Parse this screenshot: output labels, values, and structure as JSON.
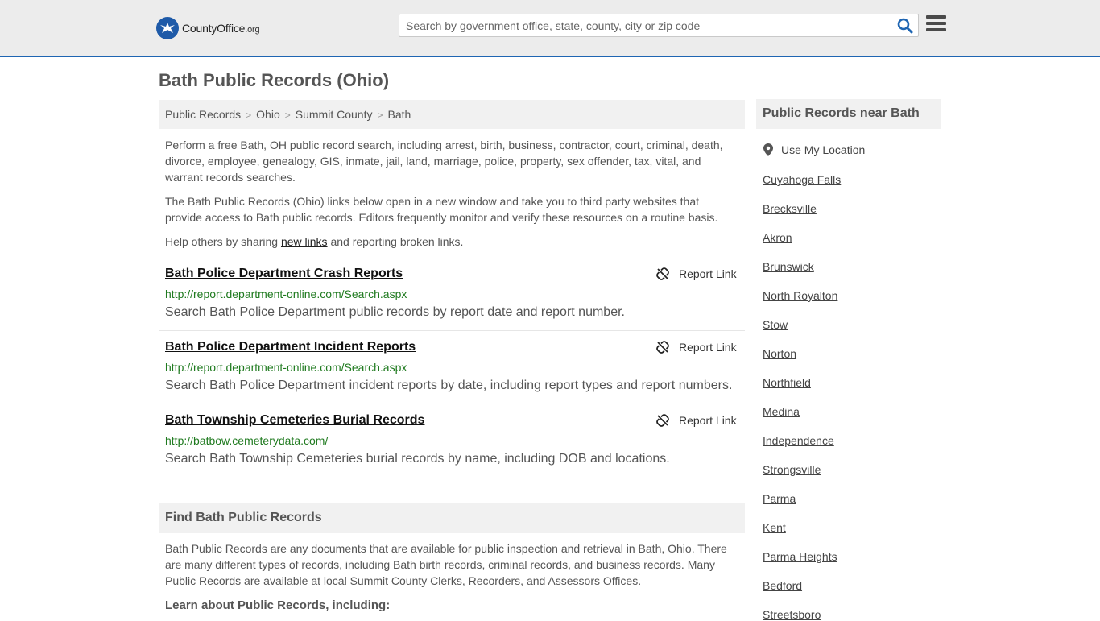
{
  "header": {
    "logo_main": "CountyOffice",
    "logo_tld": ".org",
    "search_placeholder": "Search by government office, state, county, city or zip code"
  },
  "page": {
    "title": "Bath Public Records (Ohio)"
  },
  "breadcrumb": [
    "Public Records",
    "Ohio",
    "Summit County",
    "Bath"
  ],
  "intro": {
    "p1": "Perform a free Bath, OH public record search, including arrest, birth, business, contractor, court, criminal, death, divorce, employee, genealogy, GIS, inmate, jail, land, marriage, police, property, sex offender, tax, vital, and warrant records searches.",
    "p2": "The Bath Public Records (Ohio) links below open in a new window and take you to third party websites that provide access to Bath public records. Editors frequently monitor and verify these resources on a routine basis.",
    "p3_before": "Help others by sharing ",
    "p3_link": "new links",
    "p3_after": " and reporting broken links."
  },
  "records": [
    {
      "title": "Bath Police Department Crash Reports",
      "url": "http://report.department-online.com/Search.aspx",
      "desc": "Search Bath Police Department public records by report date and report number.",
      "report_label": "Report Link"
    },
    {
      "title": "Bath Police Department Incident Reports",
      "url": "http://report.department-online.com/Search.aspx",
      "desc": "Search Bath Police Department incident reports by date, including report types and report numbers.",
      "report_label": "Report Link"
    },
    {
      "title": "Bath Township Cemeteries Burial Records",
      "url": "http://batbow.cemeterydata.com/",
      "desc": "Search Bath Township Cemeteries burial records by name, including DOB and locations.",
      "report_label": "Report Link"
    }
  ],
  "find": {
    "heading": "Find Bath Public Records",
    "text": "Bath Public Records are any documents that are available for public inspection and retrieval in Bath, Ohio. There are many different types of records, including Bath birth records, criminal records, and business records. Many Public Records are available at local Summit County Clerks, Recorders, and Assessors Offices.",
    "learn": "Learn about Public Records, including:"
  },
  "sidebar": {
    "heading": "Public Records near Bath",
    "use_location": "Use My Location",
    "cities": [
      "Cuyahoga Falls",
      "Brecksville",
      "Akron",
      "Brunswick",
      "North Royalton",
      "Stow",
      "Norton",
      "Northfield",
      "Medina",
      "Independence",
      "Strongsville",
      "Parma",
      "Kent",
      "Parma Heights",
      "Bedford",
      "Streetsboro"
    ]
  },
  "colors": {
    "accent_blue": "#1e65b2",
    "url_green": "#1f7a1f"
  }
}
